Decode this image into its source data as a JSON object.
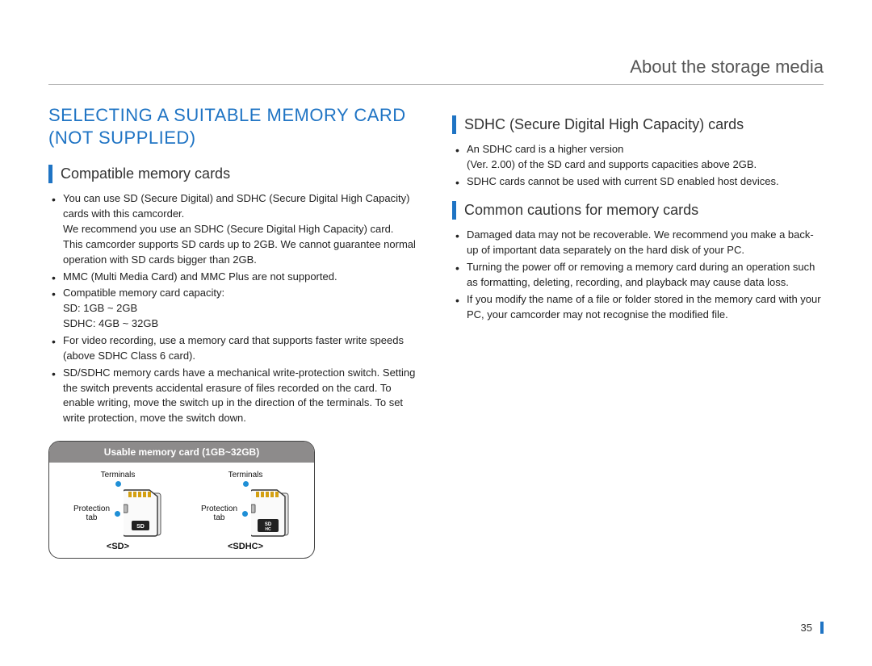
{
  "header": {
    "title": "About the storage media"
  },
  "left": {
    "heading": "SELECTING A SUITABLE MEMORY CARD (NOT SUPPLIED)",
    "section1": {
      "title": "Compatible memory cards",
      "b1a": "You can use SD (Secure Digital) and SDHC (Secure Digital High Capacity) cards with this camcorder.",
      "b1b": "We recommend you use an SDHC (Secure Digital High Capacity) card.",
      "b1c": "This camcorder supports SD cards up to 2GB. We cannot guarantee normal operation with SD cards bigger than 2GB.",
      "b2": "MMC (Multi Media Card) and MMC Plus are not supported.",
      "b3a": "Compatible memory card capacity:",
      "b3b": "SD: 1GB ~ 2GB",
      "b3c": "SDHC: 4GB ~ 32GB",
      "b4": "For video recording, use a memory card that supports faster write speeds (above SDHC Class 6 card).",
      "b5": "SD/SDHC memory cards have a mechanical write-protection switch. Setting the switch prevents accidental erasure of files recorded on the card. To enable writing, move the switch up in the direction of the terminals. To set write protection, move the switch down."
    },
    "cardbox": {
      "header": "Usable memory card (1GB~32GB)",
      "terminals": "Terminals",
      "protection_line1": "Protection",
      "protection_line2": "tab",
      "sd": "<SD>",
      "sdhc": "<SDHC>"
    }
  },
  "right": {
    "section1": {
      "title": "SDHC (Secure Digital High Capacity) cards",
      "b1a": "An SDHC card is a higher version",
      "b1b": "(Ver. 2.00) of the SD card and supports capacities above 2GB.",
      "b2": "SDHC cards cannot be used with current SD enabled host devices."
    },
    "section2": {
      "title": "Common cautions for memory cards",
      "b1": "Damaged data may not be recoverable. We recommend you make a back-up of important data separately on the hard disk of your PC.",
      "b2": "Turning the power off or removing a memory card during an operation such as formatting, deleting, recording, and playback may cause data loss.",
      "b3": "If you modify the name of a file or folder stored in the memory card with your PC, your camcorder may not recognise the modified file."
    }
  },
  "pageNumber": "35"
}
